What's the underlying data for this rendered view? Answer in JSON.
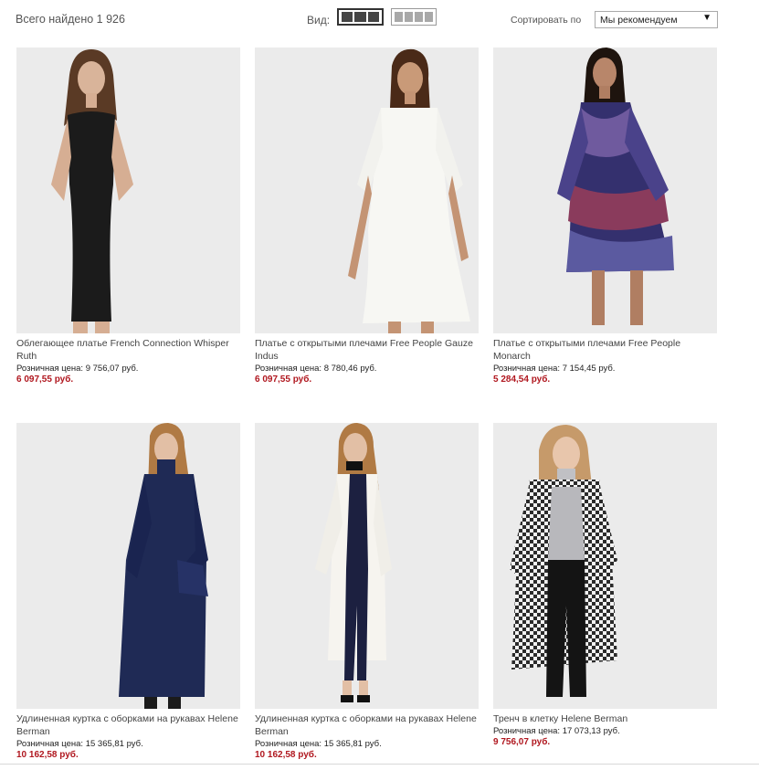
{
  "header": {
    "total_text": "Всего найдено 1 926",
    "view_label": "Вид:",
    "sort_label": "Сортировать по",
    "sort_value": "Мы рекомендуем"
  },
  "products": [
    {
      "name": "Облегающее платье French Connection Whisper Ruth",
      "retail_label": "Розничная цена:",
      "retail_price": "9 756,07 руб.",
      "sale_price": "6 097,55 руб."
    },
    {
      "name": "Платье с открытыми плечами Free People Gauze Indus",
      "retail_label": "Розничная цена:",
      "retail_price": "8 780,46 руб.",
      "sale_price": "6 097,55 руб."
    },
    {
      "name": "Платье с открытыми плечами Free People Monarch",
      "retail_label": "Розничная цена:",
      "retail_price": "7 154,45 руб.",
      "sale_price": "5 284,54 руб."
    },
    {
      "name": "Удлиненная куртка с оборками на рукавах Helene Berman",
      "retail_label": "Розничная цена:",
      "retail_price": "15 365,81 руб.",
      "sale_price": "10 162,58 руб."
    },
    {
      "name": "Удлиненная куртка с оборками на рукавах Helene Berman",
      "retail_label": "Розничная цена:",
      "retail_price": "15 365,81 руб.",
      "sale_price": "10 162,58 руб."
    },
    {
      "name": "Тренч в клетку Helene Berman",
      "retail_label": "Розничная цена:",
      "retail_price": "17 073,13 руб.",
      "sale_price": "9 756,07 руб."
    }
  ],
  "colors": {
    "sale_price": "#b0171f",
    "photo_bg": "#ececec"
  }
}
